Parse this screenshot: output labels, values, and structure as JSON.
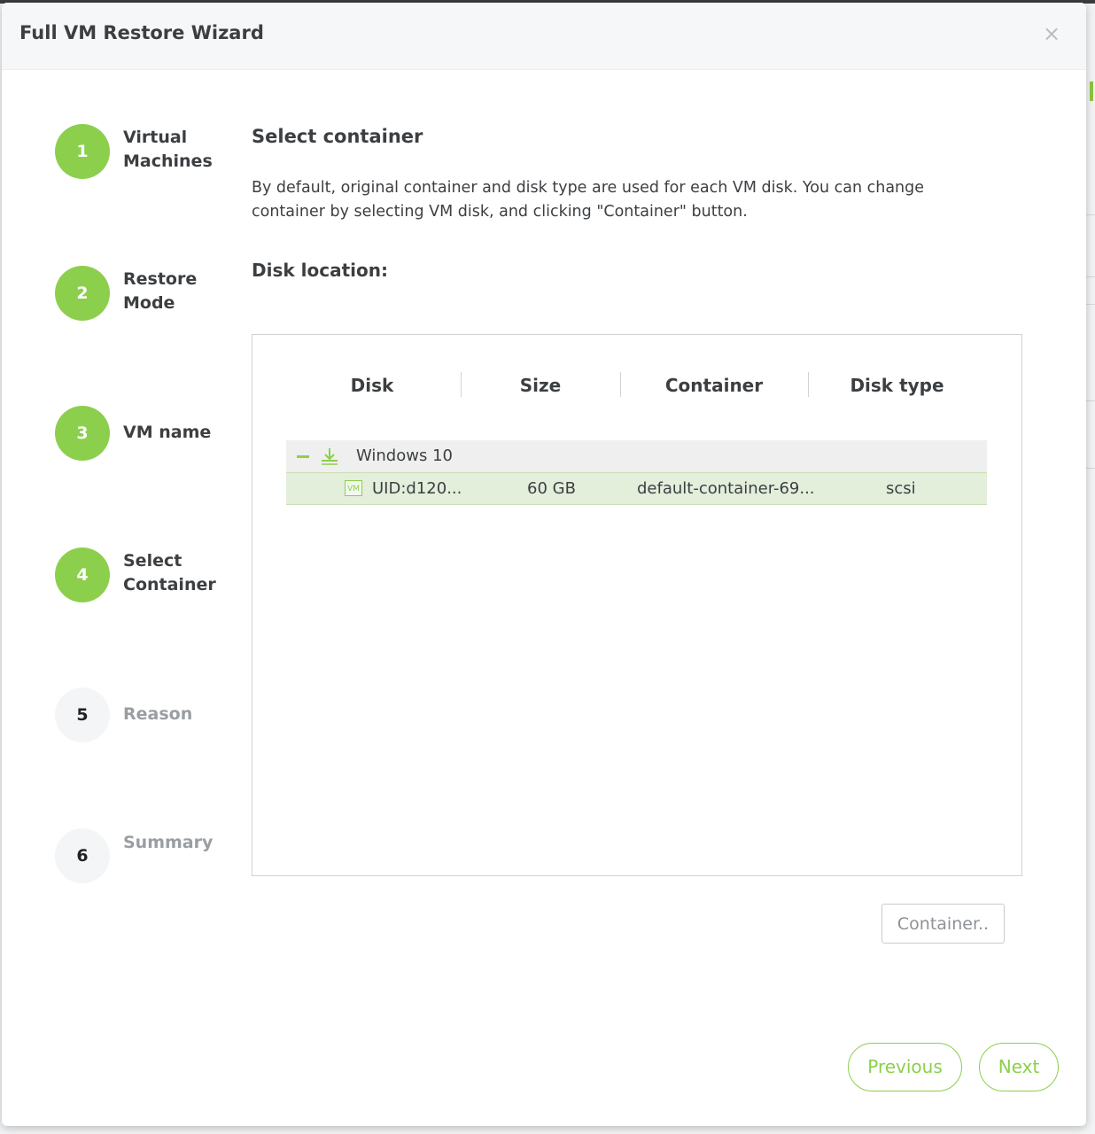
{
  "modal": {
    "title": "Full VM Restore Wizard",
    "close_glyph": "×"
  },
  "steps": [
    {
      "number": "1",
      "label_line1": "Virtual",
      "label_line2": "Machines",
      "state": "completed"
    },
    {
      "number": "2",
      "label_line1": "Restore",
      "label_line2": "Mode",
      "state": "completed"
    },
    {
      "number": "3",
      "label_line1": "VM name",
      "label_line2": "",
      "state": "completed"
    },
    {
      "number": "4",
      "label_line1": "Select",
      "label_line2": "Container",
      "state": "active"
    },
    {
      "number": "5",
      "label_line1": "Reason",
      "label_line2": "",
      "state": "pending"
    },
    {
      "number": "6",
      "label_line1": "Summary",
      "label_line2": "",
      "state": "pending"
    }
  ],
  "content": {
    "title": "Select container",
    "description": "By default, original container and disk type are used for each VM disk. You can change container by selecting VM disk, and clicking \"Container\" button.",
    "disk_location_label": "Disk location:"
  },
  "table": {
    "columns": [
      "Disk",
      "Size",
      "Container",
      "Disk type"
    ],
    "group": {
      "name": "Windows 10",
      "expanded": true,
      "icon": "download-icon"
    },
    "rows": [
      {
        "badge": "VM",
        "disk": "UID:d120...",
        "size": "60 GB",
        "container": "default-container-69...",
        "disk_type": "scsi",
        "selected": true
      }
    ]
  },
  "buttons": {
    "container": "Container..",
    "previous": "Previous",
    "next": "Next"
  },
  "colors": {
    "accent": "#8ccf4d",
    "selected_row": "#e3eedb",
    "text": "#3c3f42",
    "muted": "#9a9ea2"
  }
}
